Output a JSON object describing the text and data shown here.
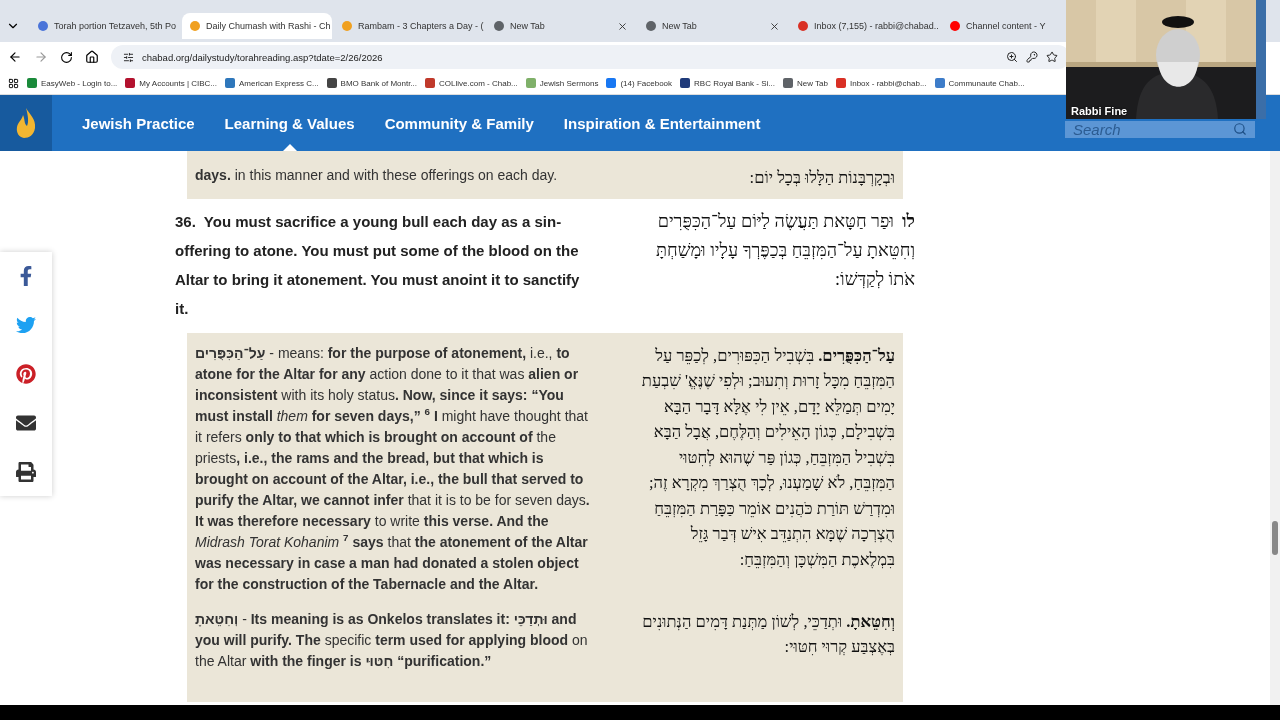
{
  "browser": {
    "tabs": [
      {
        "title": "Torah portion Tetzaveh, 5th Po",
        "color": "#4a74d9",
        "selected": false
      },
      {
        "title": "Daily Chumash with Rashi - Ch",
        "color": "#f0a020",
        "selected": true
      },
      {
        "title": "Rambam - 3 Chapters a Day - (",
        "color": "#f0a020",
        "selected": false
      },
      {
        "title": "New Tab",
        "color": "#5f6368",
        "selected": false
      },
      {
        "title": "New Tab",
        "color": "#5f6368",
        "selected": false
      },
      {
        "title": "Inbox (7,155) - rabbi@chabad..",
        "color": "#d93025",
        "selected": false
      },
      {
        "title": "Channel content - Y",
        "color": "#ff0000",
        "selected": false
      }
    ],
    "address": "chabad.org/dailystudy/torahreading.asp?tdate=2/26/2026",
    "bookmarks": [
      {
        "label": "EasyWeb - Login to...",
        "color": "#1a8a3a"
      },
      {
        "label": "My Accounts | CIBC...",
        "color": "#b3122e"
      },
      {
        "label": "American Express C...",
        "color": "#2e77bb"
      },
      {
        "label": "BMO Bank of Montr...",
        "color": "#444444"
      },
      {
        "label": "COLlive.com - Chab...",
        "color": "#c0392b"
      },
      {
        "label": "Jewish Sermons",
        "color": "#7fb069"
      },
      {
        "label": "(14) Facebook",
        "color": "#1877f2"
      },
      {
        "label": "RBC Royal Bank - Si...",
        "color": "#1f3a7a"
      },
      {
        "label": "New Tab",
        "color": "#5f6368"
      },
      {
        "label": "Inbox - rabbi@chab...",
        "color": "#d93025"
      },
      {
        "label": "Communaute Chab...",
        "color": "#3d7cc9"
      }
    ]
  },
  "site_nav": {
    "items": [
      {
        "label": "Jewish Practice",
        "selected": false
      },
      {
        "label": "Learning & Values",
        "selected": true
      },
      {
        "label": "Community & Family",
        "selected": false
      },
      {
        "label": "Inspiration & Entertainment",
        "selected": false
      }
    ],
    "search": {
      "placeholder": "Search"
    }
  },
  "video_overlay": {
    "name": "Rabbi Fine"
  },
  "reading": {
    "prev_rashi": {
      "english": "**days.** in this manner and with these offerings on each day.",
      "hebrew": "וּבְקָרְבָּנוֹת הַלָּלוּ בְּכָל יוֹם:"
    },
    "verse": {
      "number": "36.",
      "english": "You must sacrifice a young bull each day as a sin-offering to atone. You must put some of the blood on the Altar to bring it atonement. You must anoint it to sanctify it.",
      "hebrew_number": "לו",
      "hebrew": "וּפַר חַטָּאת תַּעֲשֶׂה לַיּוֹם עַל־הַכִּפֻּרִים וְחִטֵּאתָ עַל־הַמִּזְבֵּחַ בְּכַפֶּרְךָ עָלָיו וּמָשַׁחְתָּ אֹתוֹ לְקַדְּשׁוֹ:"
    },
    "rashi": [
      {
        "english": "**עַל־הַכִּפֻּרִים** - means: **for the purpose of atonement,** i.e., **to atone for the Altar for any** action done to it that was **alien or inconsistent** with its holy status**. Now, since it says: “You must install** *them* **for seven days,”** **$^{6}$** **I** might have thought that it refers **only to that which is brought on account of** the priests**, i.e., the rams and the bread, but that which is brought on account of the Altar, i.e., the bull that served to purify the Altar, we cannot infer** that it is to be for seven days**. It was therefore necessary** to write **this verse. And the** *Midrash Torat Kohanim* **$^{7}$** **says** that **the atonement of the Altar was necessary in case a man had donated a stolen object for the construction of the Tabernacle and the Altar.**",
        "hebrew": "**עַל־הַכִּפֻּרִים.** בִּשְׁבִיל הַכִּפּוּרִים, לְכַפֵּר עַל הַמִּזְבֵּחַ מִכָּל זָרוּת וְתִעוּב; וּלְפִי שֶׁנֶּאֱ' שִׁבְעַת יָמִים תְּמַלֵּא יָדָם, אֵין לִי אֶלָּא דָּבָר הַבָּא בִּשְׁבִילָם, כְּגוֹן הָאֵילִים וְהַלֶּחֶם, אֲבָל הַבָּא בִּשְׁבִיל הַמִּזְבֵּחַ, כְּגוֹן פַּר שֶׁהוּא לְחִטּוּי הַמִּזְבֵּחַ, לֹא שָׁמַעְנוּ, לְכָךְ הֻצְרַךְ מִקְרָא זֶה; וּמִדְרַשׁ תּוֹרַת כֹּהֲנִים אוֹמֵר כַּפָּרַת הַמִּזְבֵּחַ הֻצְרְכָה שֶׁמָּא הִתְנַדֵּב אִישׁ דְּבַר גָּזֵל בִּמְלֶאכֶת הַמִּשְׁכָּן וְהַמִּזְבֵּחַ:"
      },
      {
        "english": "**וְחִטֵּאתָ** - **Its meaning is as Onkelos translates it: וּתְדַכֵּי and you will purify. The** specific **term used for applying blood** on the Altar **with the finger is חִטּוּי “purification.”**",
        "hebrew": "**וְחִטֵּאתָ.** וּתְדַכֵּי, לְשׁוֹן מַתְּנַת דָּמִים הַנְּתוּנִים בְּאֶצְבַּע קְרוּי חִטּוּי:"
      }
    ]
  }
}
